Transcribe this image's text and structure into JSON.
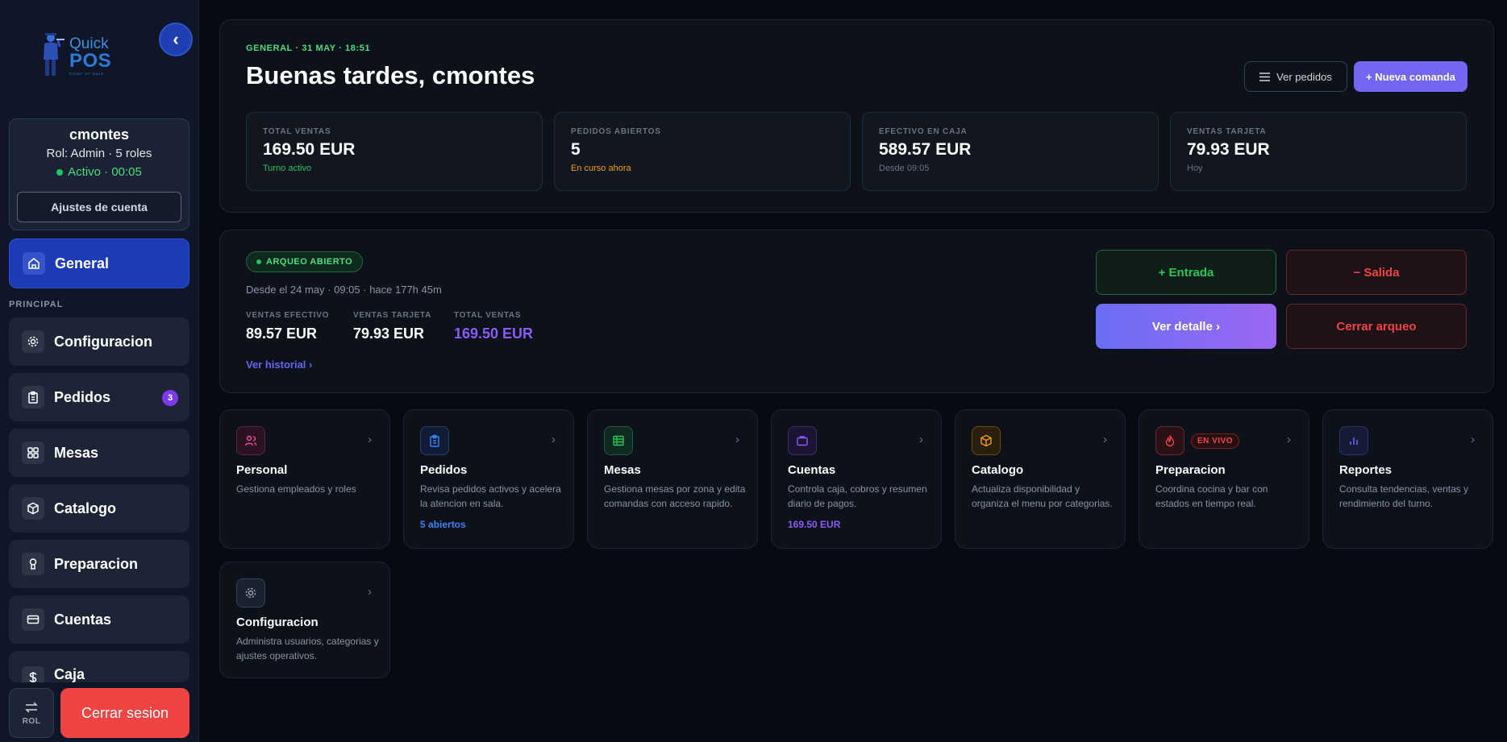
{
  "logo": {
    "word1": "Quick",
    "word2": "POS",
    "tagline": "POINT OF SALE"
  },
  "sidebar": {
    "collapse_label": "‹",
    "user": {
      "name": "cmontes",
      "role": "Rol: Admin · 5 roles",
      "status": "Activo · 00:05",
      "account_button": "Ajustes de cuenta"
    },
    "active_item": {
      "label": "General"
    },
    "section_label": "PRINCIPAL",
    "items": [
      {
        "label": "Configuracion"
      },
      {
        "label": "Pedidos",
        "badge": "3"
      },
      {
        "label": "Mesas"
      },
      {
        "label": "Catalogo"
      },
      {
        "label": "Preparacion"
      },
      {
        "label": "Cuentas"
      },
      {
        "label": "Caja"
      }
    ],
    "role_label": "ROL",
    "logout_label": "Cerrar sesion"
  },
  "header": {
    "eyebrow": "GENERAL · 31 MAY · 18:51",
    "greeting": "Buenas tardes, cmontes",
    "view_orders": "Ver pedidos",
    "new_order": "+ Nueva comanda"
  },
  "stats": [
    {
      "label": "TOTAL VENTAS",
      "value": "169.50 EUR",
      "sub": "Turno activo",
      "sub_color": "#22c55e"
    },
    {
      "label": "PEDIDOS ABIERTOS",
      "value": "5",
      "sub": "En curso ahora",
      "sub_color": "#f59e0b"
    },
    {
      "label": "EFECTIVO EN CAJA",
      "value": "589.57 EUR",
      "sub": "Desde 09:05",
      "sub_color": "#6b7385"
    },
    {
      "label": "VENTAS TARJETA",
      "value": "79.93 EUR",
      "sub": "Hoy",
      "sub_color": "#6b7385"
    }
  ],
  "arqueo": {
    "badge": "ARQUEO ABIERTO",
    "since": "Desde el 24 may · 09:05 · hace 177h 45m",
    "cash_label": "VENTAS EFECTIVO",
    "cash_value": "89.57 EUR",
    "card_label": "VENTAS TARJETA",
    "card_value": "79.93 EUR",
    "total_label": "TOTAL VENTAS",
    "total_value": "169.50 EUR",
    "history": "Ver historial ›",
    "entrada": "+ Entrada",
    "salida": "− Salida",
    "detalle": "Ver detalle ›",
    "cerrar": "Cerrar arqueo"
  },
  "cards": [
    {
      "title": "Personal",
      "desc": "Gestiona empleados y roles"
    },
    {
      "title": "Pedidos",
      "desc": "Revisa pedidos activos y acelera la atencion en sala.",
      "extra": "5 abiertos",
      "extra_color": "#3b82f6"
    },
    {
      "title": "Mesas",
      "desc": "Gestiona mesas por zona y edita comandas con acceso rapido."
    },
    {
      "title": "Cuentas",
      "desc": "Controla caja, cobros y resumen diario de pagos.",
      "extra": "169.50 EUR",
      "extra_color": "#8b5cf6"
    },
    {
      "title": "Catalogo",
      "desc": "Actualiza disponibilidad y organiza el menu por categorias."
    },
    {
      "title": "Preparacion",
      "desc": "Coordina cocina y bar con estados en tiempo real.",
      "badge": "EN VIVO"
    },
    {
      "title": "Reportes",
      "desc": "Consulta tendencias, ventas y rendimiento del turno."
    },
    {
      "title": "Configuracion",
      "desc": "Administra usuarios, categorias y ajustes operativos."
    }
  ],
  "colors": {
    "accent": "#7366f4",
    "active_nav": "#1e3bb6",
    "success": "#22c55e",
    "danger": "#ef4444",
    "warning": "#f59e0b",
    "violet": "#8b5cf6"
  }
}
